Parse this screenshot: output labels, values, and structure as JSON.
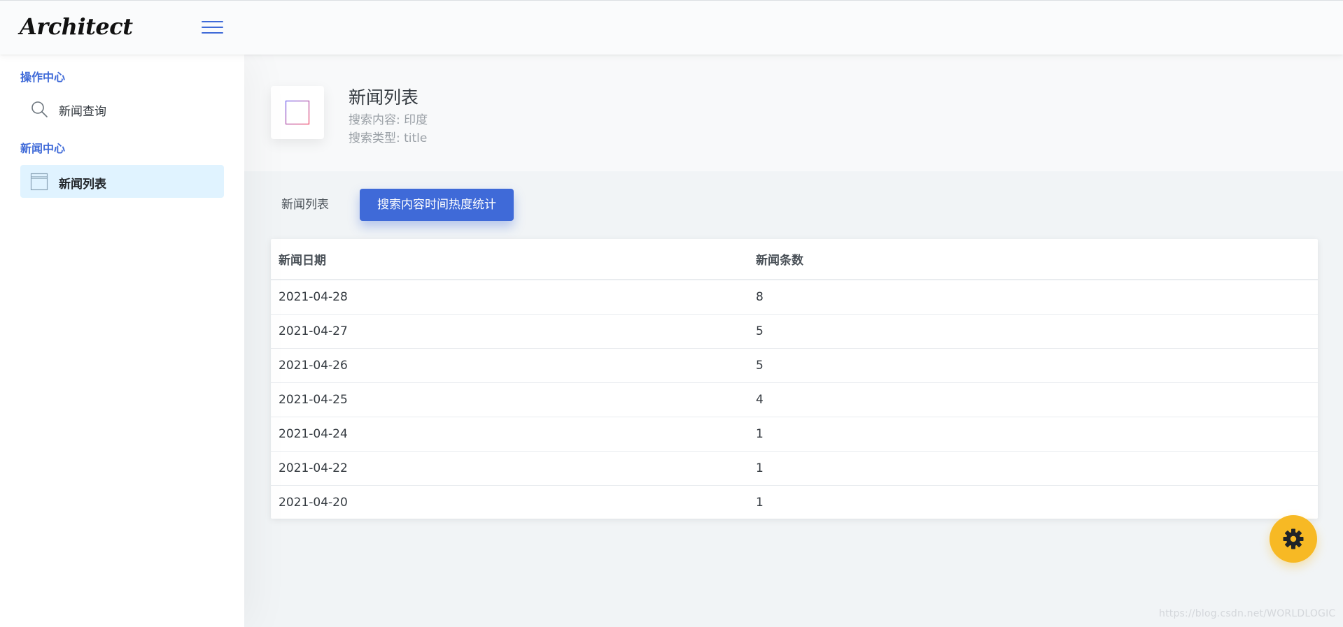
{
  "header": {
    "logo_text": "Architect"
  },
  "sidebar": {
    "sections": [
      {
        "heading": "操作中心",
        "items": [
          {
            "label": "新闻查询",
            "icon": "search-icon",
            "active": false
          }
        ]
      },
      {
        "heading": "新闻中心",
        "items": [
          {
            "label": "新闻列表",
            "icon": "browser-window-icon",
            "active": true
          }
        ]
      }
    ]
  },
  "page_title": {
    "heading": "新闻列表",
    "subtitle_1": "搜索内容: 印度",
    "subtitle_2": "搜索类型: title",
    "icon": "browser-window-icon"
  },
  "tabs": [
    {
      "label": "新闻列表",
      "active": false
    },
    {
      "label": "搜索内容时间热度统计",
      "active": true
    }
  ],
  "table": {
    "columns": [
      "新闻日期",
      "新闻条数"
    ],
    "rows": [
      [
        "2021-04-28",
        "8"
      ],
      [
        "2021-04-27",
        "5"
      ],
      [
        "2021-04-26",
        "5"
      ],
      [
        "2021-04-25",
        "4"
      ],
      [
        "2021-04-24",
        "1"
      ],
      [
        "2021-04-22",
        "1"
      ],
      [
        "2021-04-20",
        "1"
      ]
    ]
  },
  "floating_button": {
    "icon": "gear-icon"
  },
  "watermark": "https://blog.csdn.net/WORLDLOGIC",
  "colors": {
    "primary": "#3f6ad8",
    "warning": "#f7b924",
    "active_nav_bg": "#e0f3ff"
  }
}
